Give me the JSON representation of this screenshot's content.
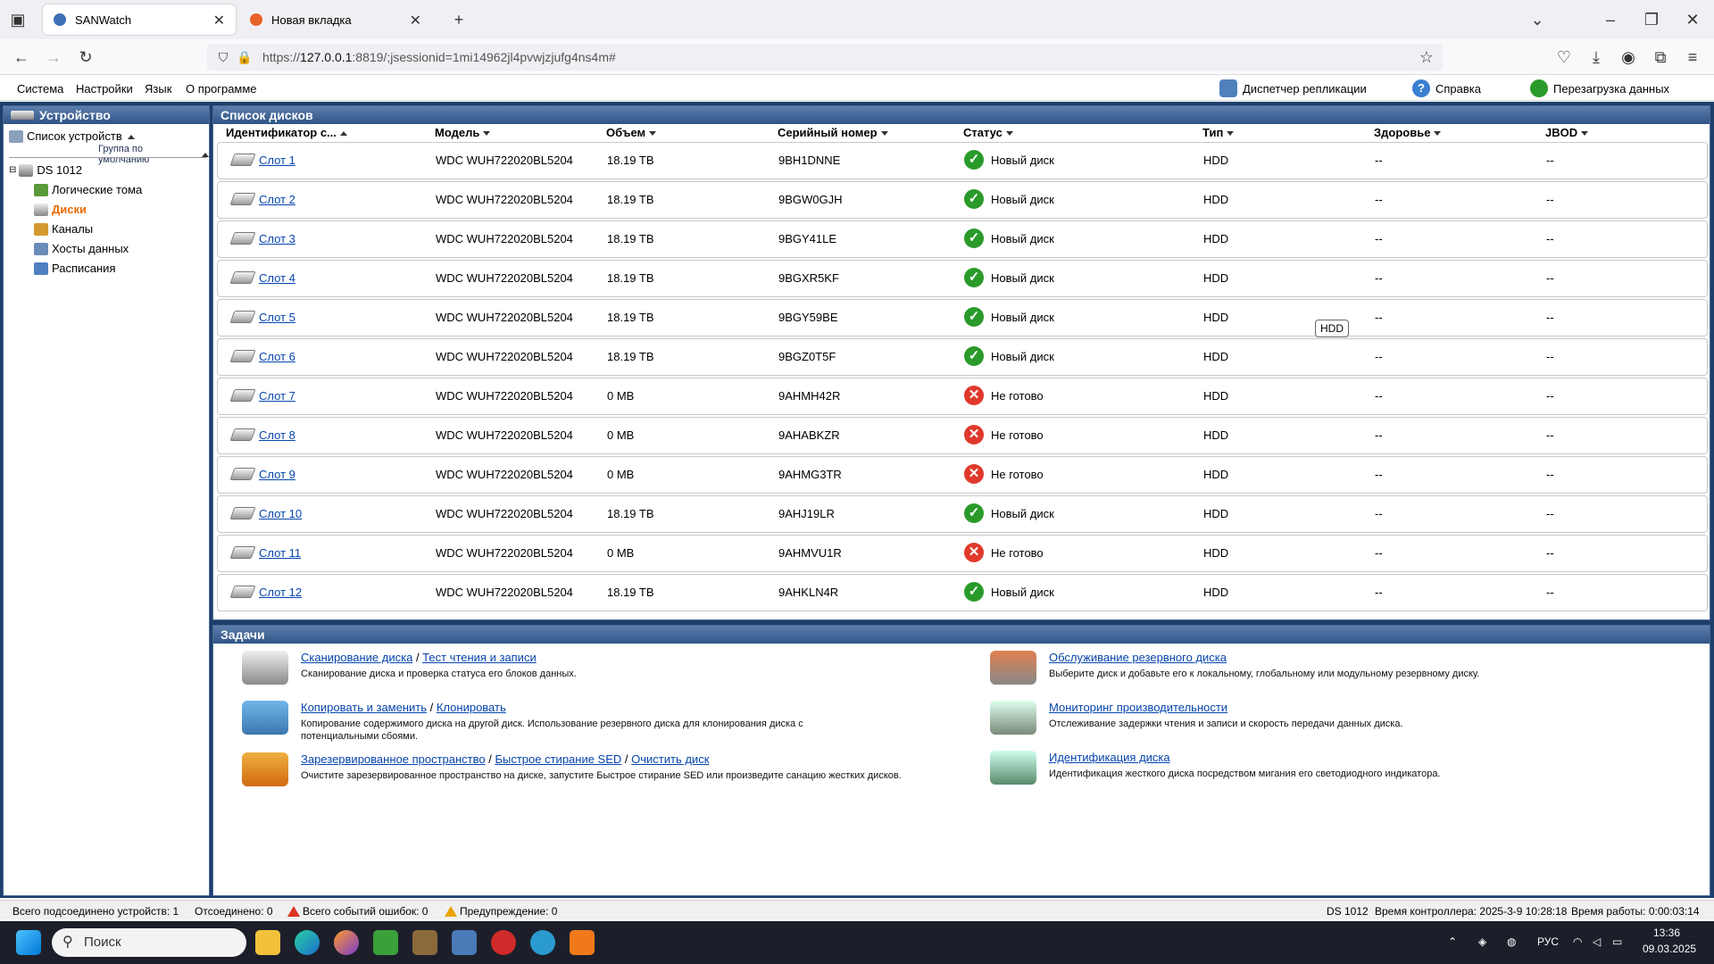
{
  "browser": {
    "tabs": [
      {
        "title": "SANWatch"
      },
      {
        "title": "Новая вкладка"
      }
    ],
    "url_prefix": "https://",
    "url_host": "127.0.0.1",
    "url_rest": ":8819/;jsessionid=1mi14962jl4pvwjzjufg4ns4m#"
  },
  "menu": {
    "items": [
      "Система",
      "Настройки",
      "Язык",
      "О программе"
    ],
    "tools": [
      "Диспетчер репликации",
      "Справка",
      "Перезагрузка данных"
    ]
  },
  "left": {
    "title": "Устройство",
    "device_list": "Список устройств",
    "group": "Группа по умолчанию",
    "device": "DS 1012",
    "nodes": [
      "Логические тома",
      "Диски",
      "Каналы",
      "Хосты данных",
      "Расписания"
    ]
  },
  "disks": {
    "title": "Список дисков",
    "columns": [
      "Идентификатор с...",
      "Модель",
      "Объем",
      "Серийный номер",
      "Статус",
      "Тип",
      "Здоровье",
      "JBOD"
    ],
    "rows": [
      {
        "id": "Слот 1",
        "model": "WDC WUH722020BL5204",
        "size": "18.19 TB",
        "serial": "9BH1DNNE",
        "status": "Новый диск",
        "ok": true,
        "type": "HDD",
        "health": "--",
        "jbod": "--"
      },
      {
        "id": "Слот 2",
        "model": "WDC WUH722020BL5204",
        "size": "18.19 TB",
        "serial": "9BGW0GJH",
        "status": "Новый диск",
        "ok": true,
        "type": "HDD",
        "health": "--",
        "jbod": "--"
      },
      {
        "id": "Слот 3",
        "model": "WDC WUH722020BL5204",
        "size": "18.19 TB",
        "serial": "9BGY41LE",
        "status": "Новый диск",
        "ok": true,
        "type": "HDD",
        "health": "--",
        "jbod": "--"
      },
      {
        "id": "Слот 4",
        "model": "WDC WUH722020BL5204",
        "size": "18.19 TB",
        "serial": "9BGXR5KF",
        "status": "Новый диск",
        "ok": true,
        "type": "HDD",
        "health": "--",
        "jbod": "--"
      },
      {
        "id": "Слот 5",
        "model": "WDC WUH722020BL5204",
        "size": "18.19 TB",
        "serial": "9BGY59BE",
        "status": "Новый диск",
        "ok": true,
        "type": "HDD",
        "health": "--",
        "jbod": "--"
      },
      {
        "id": "Слот 6",
        "model": "WDC WUH722020BL5204",
        "size": "18.19 TB",
        "serial": "9BGZ0T5F",
        "status": "Новый диск",
        "ok": true,
        "type": "HDD",
        "health": "--",
        "jbod": "--"
      },
      {
        "id": "Слот 7",
        "model": "WDC WUH722020BL5204",
        "size": "0 MB",
        "serial": "9AHMH42R",
        "status": "Не готово",
        "ok": false,
        "type": "HDD",
        "health": "--",
        "jbod": "--"
      },
      {
        "id": "Слот 8",
        "model": "WDC WUH722020BL5204",
        "size": "0 MB",
        "serial": "9AHABKZR",
        "status": "Не готово",
        "ok": false,
        "type": "HDD",
        "health": "--",
        "jbod": "--"
      },
      {
        "id": "Слот 9",
        "model": "WDC WUH722020BL5204",
        "size": "0 MB",
        "serial": "9AHMG3TR",
        "status": "Не готово",
        "ok": false,
        "type": "HDD",
        "health": "--",
        "jbod": "--"
      },
      {
        "id": "Слот 10",
        "model": "WDC WUH722020BL5204",
        "size": "18.19 TB",
        "serial": "9AHJ19LR",
        "status": "Новый диск",
        "ok": true,
        "type": "HDD",
        "health": "--",
        "jbod": "--"
      },
      {
        "id": "Слот 11",
        "model": "WDC WUH722020BL5204",
        "size": "0 MB",
        "serial": "9AHMVU1R",
        "status": "Не готово",
        "ok": false,
        "type": "HDD",
        "health": "--",
        "jbod": "--"
      },
      {
        "id": "Слот 12",
        "model": "WDC WUH722020BL5204",
        "size": "18.19 TB",
        "serial": "9AHKLN4R",
        "status": "Новый диск",
        "ok": true,
        "type": "HDD",
        "health": "--",
        "jbod": "--"
      }
    ],
    "tooltip": "HDD"
  },
  "tasks": {
    "title": "Задачи",
    "items": [
      {
        "links": [
          "Сканирование диска",
          "Тест чтения и записи"
        ],
        "desc": "Сканирование диска и проверка статуса его блоков данных."
      },
      {
        "links": [
          "Копировать и заменить",
          "Клонировать"
        ],
        "desc": "Копирование содержимого диска на другой диск. Использование резервного диска для клонирования диска с потенциальными сбоями."
      },
      {
        "links": [
          "Зарезервированное пространство",
          "Быстрое стирание SED",
          "Очистить диск"
        ],
        "desc": "Очистите зарезервированное пространство на диске, запустите Быстрое стирание SED или произведите санацию жестких дисков."
      },
      {
        "links": [
          "Обслуживание резервного диска"
        ],
        "desc": "Выберите диск и добавьте его к локальному, глобальному или модульному резервному диску."
      },
      {
        "links": [
          "Мониторинг производительности"
        ],
        "desc": "Отслеживание задержки чтения и записи и скорость передачи данных диска."
      },
      {
        "links": [
          "Идентификация диска"
        ],
        "desc": "Идентификация жесткого диска посредством мигания его светодиодного индикатора."
      }
    ]
  },
  "status": {
    "connected": "Всего подсоединено устройств: 1",
    "disconnected": "Отсоединено: 0",
    "errors": "Всего событий ошибок: 0",
    "warnings": "Предупреждение: 0",
    "device": "DS 1012",
    "controller_time": "Время контроллера: 2025-3-9 10:28:18",
    "uptime": "Время работы: 0:00:03:14"
  },
  "taskbar": {
    "search": "Поиск",
    "lang": "РУС",
    "time": "13:36",
    "date": "09.03.2025"
  }
}
